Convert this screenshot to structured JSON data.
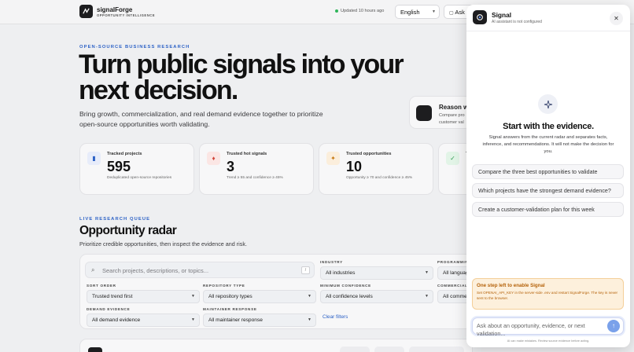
{
  "header": {
    "brand": "signalForge",
    "brand_sub": "OPPORTUNITY INTELLIGENCE",
    "updated": "Updated 10 hours ago",
    "language": "English",
    "ask": "Ask"
  },
  "hero": {
    "eyebrow": "OPEN-SOURCE BUSINESS RESEARCH",
    "title": "Turn public signals into your next decision.",
    "lead": "Bring growth, commercialization, and real demand evidence together to prioritize open-source opportunities worth validating."
  },
  "reason": {
    "title": "Reason wi",
    "line1": "Compare pro",
    "line2": "customer val"
  },
  "stats": [
    {
      "title": "Tracked projects",
      "value": "595",
      "sub": "Deduplicated open-source repositories",
      "icon": "bar-chart-icon"
    },
    {
      "title": "Trusted hot signals",
      "value": "3",
      "sub": "Trend ≥ 55 and confidence ≥ 45%",
      "icon": "flame-icon"
    },
    {
      "title": "Trusted opportunities",
      "value": "10",
      "sub": "Opportunity ≥ 70 and confidence ≥ 45%",
      "icon": "sparkle-icon"
    },
    {
      "title": "T",
      "value": "",
      "sub": "",
      "icon": "check-icon"
    }
  ],
  "radar": {
    "eyebrow": "LIVE RESEARCH QUEUE",
    "title": "Opportunity radar",
    "sub": "Prioritize credible opportunities, then inspect the evidence and risk.",
    "search_placeholder": "Search projects, descriptions, or topics...",
    "search_key": "/",
    "clear": "Clear filters",
    "filters": {
      "industry_label": "INDUSTRY",
      "industry_value": "All industries",
      "programming_label": "PROGRAMMING",
      "programming_value": "All languag",
      "sort_label": "SORT ORDER",
      "sort_value": "Trusted trend first",
      "repo_label": "REPOSITORY TYPE",
      "repo_value": "All repository types",
      "confidence_label": "MINIMUM CONFIDENCE",
      "confidence_value": "All confidence levels",
      "commercial_label": "COMMERCIAL",
      "commercial_value": "All commerc",
      "demand_label": "DEMAND EVIDENCE",
      "demand_value": "All demand evidence",
      "maintainer_label": "MAINTAINER RESPONSE",
      "maintainer_value": "All maintainer response"
    }
  },
  "assistant": {
    "title": "Signal",
    "subtitle": "AI assistant is not configured",
    "heading": "Start with the evidence.",
    "intro": "Signal answers from the current radar and separates facts, inference, and recommendations. It will not make the decision for you.",
    "suggestions": [
      "Compare the three best opportunities to validate",
      "Which projects have the strongest demand evidence?",
      "Create a customer-validation plan for this week"
    ],
    "warning_title": "One step left to enable Signal",
    "warning_body": "Set OPENAI_API_KEY in the server-side .env and restart SignalForge. The key is never sent to the browser.",
    "input_placeholder": "Ask about an opportunity, evidence, or next validation...",
    "send": "↑",
    "disclaimer": "AI can make mistakes. Review source evidence before acting."
  }
}
